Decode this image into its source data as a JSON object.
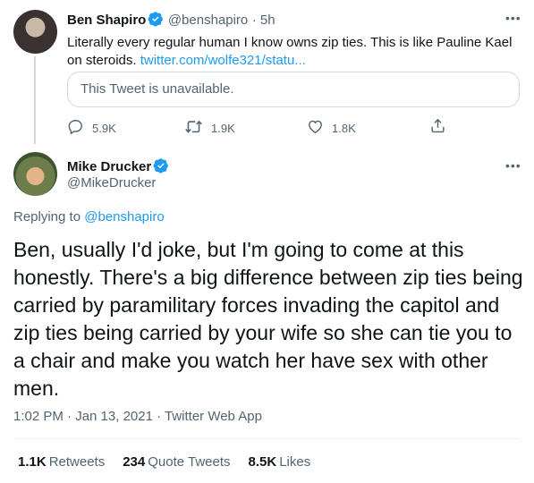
{
  "parent_tweet": {
    "name": "Ben Shapiro",
    "handle": "@benshapiro",
    "time": "· 5h",
    "text": "Literally every regular human I know owns zip ties. This is like Pauline Kael on steroids.",
    "link": "twitter.com/wolfe321/statu...",
    "quoted_unavailable": "This Tweet is unavailable.",
    "replies": "5.9K",
    "retweets": "1.9K",
    "likes": "1.8K",
    "more_icon": "ellipsis-icon"
  },
  "main_tweet": {
    "name": "Mike Drucker",
    "handle": "@MikeDrucker",
    "replying_prefix": "Replying to",
    "replying_handle": "@benshapiro",
    "text": "Ben, usually I'd joke, but I'm going to come at this honestly. There's a big difference between zip ties being carried by paramilitary forces invading the capitol and zip ties being carried by your wife so she can tie you to a chair and make you watch her have sex with other men.",
    "meta": "1:02 PM · Jan 13, 2021 · Twitter Web App",
    "stats": {
      "retweets_count": "1.1K",
      "retweets_label": "Retweets",
      "quotes_count": "234",
      "quotes_label": "Quote Tweets",
      "likes_count": "8.5K",
      "likes_label": "Likes"
    }
  },
  "colors": {
    "accent": "#1d9bf0",
    "muted": "#536471",
    "text": "#0f1419",
    "border": "#cfd9de"
  }
}
